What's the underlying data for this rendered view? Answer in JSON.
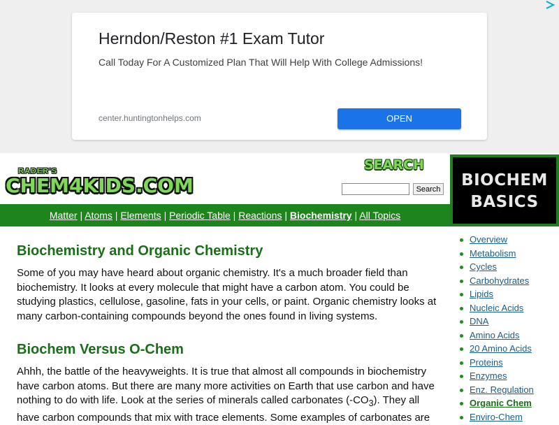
{
  "ad": {
    "headline": "Herndon/Reston #1 Exam Tutor",
    "subline": "Call Today For A Customized Plan That Will Help With College Admissions!",
    "url": "center.huntingtonhelps.com",
    "button_label": "OPEN"
  },
  "header": {
    "logo_small": "RADER'S",
    "logo_big": "CHEM4KIDS.COM",
    "search_title": "SEARCH",
    "search_value": "",
    "search_button": "Search"
  },
  "banner": {
    "line1": "BIOCHEM",
    "line2": "BASICS"
  },
  "nav": {
    "items": [
      "Matter",
      "Atoms",
      "Elements",
      "Periodic Table",
      "Reactions",
      "Biochemistry",
      "All Topics"
    ],
    "active": "Biochemistry",
    "separator": "|"
  },
  "main": {
    "heading1": "Biochemistry and Organic Chemistry",
    "para1": "Some of you may have heard about organic chemistry. It's a much broader field than biochemistry. It looks at every molecule that might have a carbon atom. You could be studying plastics, cellulose, gasoline, fats in your cells, or paint. Organic chemistry looks at many carbon-containing compounds beyond the ones found in living systems.",
    "heading2": "Biochem Versus O-Chem",
    "para2_a": "Ahhh, the battle of the heavyweights. It is true that almost all compounds in biochemistry have carbon atoms. But there are many more activities on Earth that use carbon and have nothing to do with life. Look at the series of minerals called carbonates (-CO",
    "para2_sub": "3",
    "para2_b": "). They all have carbon compounds that mix with trace elements. Some examples of carbonates are"
  },
  "sidebar": {
    "items": [
      "Overview",
      "Metabolism",
      "Cycles",
      "Carbohydrates",
      "Lipids",
      "Nucleic Acids",
      "DNA",
      "Amino Acids",
      "20 Amino Acids",
      "Proteins",
      "Enzymes",
      "Enz. Regulation",
      "Organic Chem",
      "Enviro-Chem"
    ],
    "current": "Organic Chem"
  },
  "colors": {
    "nav_green": "#1e841e",
    "heading_green": "#1a6e1a",
    "ad_button_blue": "#1a73e8",
    "sidebar_link": "#1a5e8a"
  },
  "icons": {
    "ad_choices": "ad-choices-icon"
  }
}
